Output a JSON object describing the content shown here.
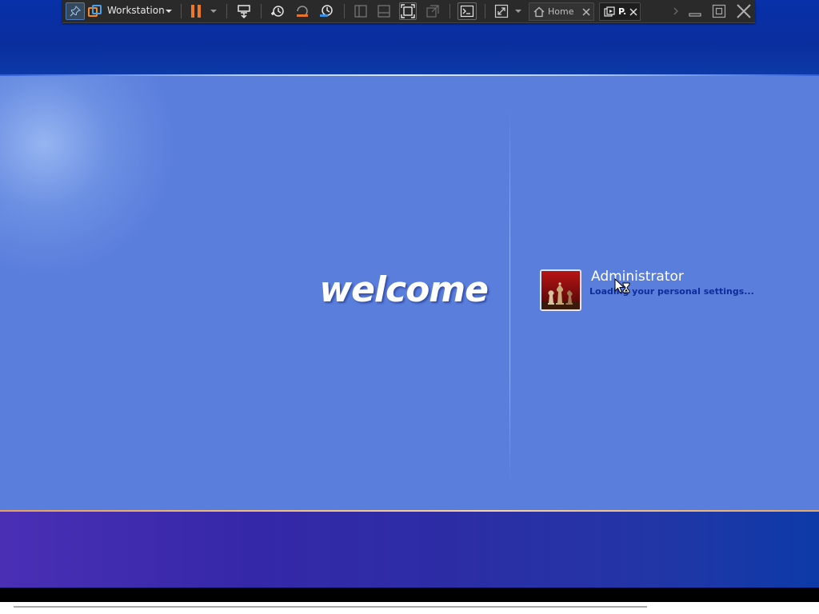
{
  "toolbar": {
    "product_label": "Workstation",
    "tabs": [
      {
        "label": "Home",
        "icon": "home-icon"
      },
      {
        "label": "P.",
        "icon": "vm-icon"
      }
    ],
    "icons": [
      "pin-icon",
      "workstation-icon",
      "pause-icon",
      "send-keys-icon",
      "snapshot-take-icon",
      "snapshot-revert-icon",
      "snapshot-manager-icon",
      "sidebar-icon",
      "thumbnail-bar-icon",
      "full-screen-icon",
      "unity-icon",
      "console-icon",
      "stretch-icon",
      "minimize-icon",
      "restore-icon",
      "close-icon"
    ]
  },
  "welcome_screen": {
    "welcome_text": "welcome",
    "user": {
      "name": "Administrator",
      "status": "Loading your personal settings...",
      "picture": "chess-pieces-picture"
    },
    "cursor": "busy-cursor"
  },
  "colors": {
    "top_band": "#0a2e9e",
    "main_panel": "#5a7edc",
    "bottom_band": "#3528a8",
    "accent_line": "#f4c48b",
    "status_text": "#0d2d9c",
    "pause_orange": "#f07822"
  }
}
